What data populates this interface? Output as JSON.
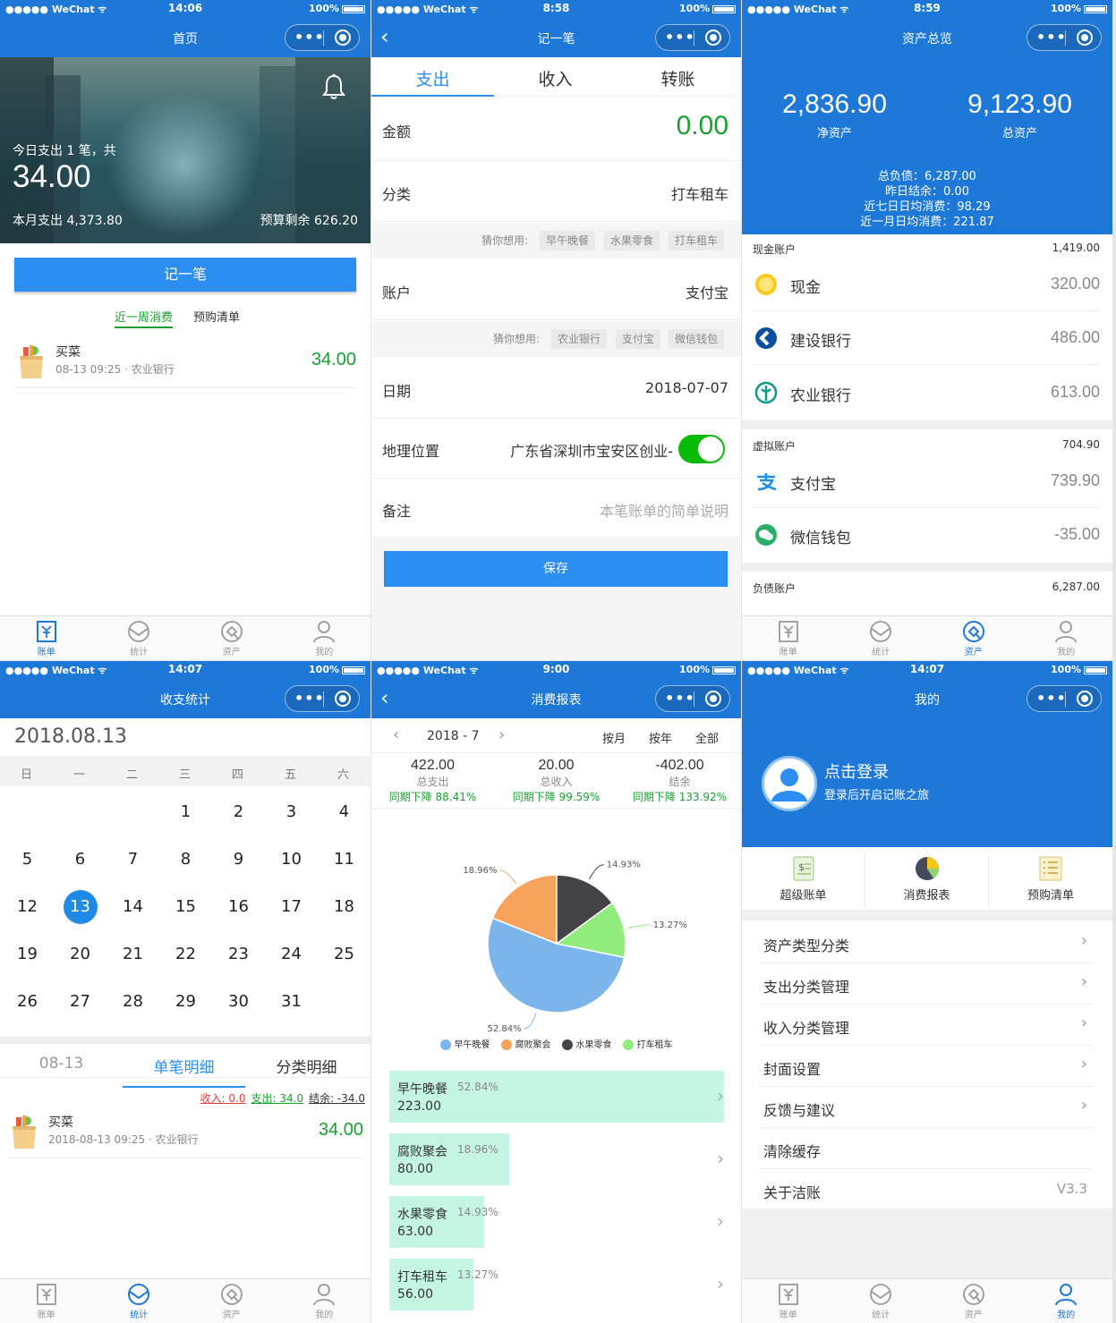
{
  "status": {
    "carrier": "●●●●● WeChat ᯤ",
    "battery": "100%",
    "times": [
      "14:06",
      "8:58",
      "8:59",
      "14:07",
      "9:00",
      "14:07"
    ]
  },
  "tabbar": {
    "bill": "账单",
    "stats": "统计",
    "assets": "资产",
    "me": "我的"
  },
  "screen1": {
    "title": "首页",
    "today_line": "今日支出 1 笔，共",
    "today_amount": "34.00",
    "month_spend": "本月支出 4,373.80",
    "budget_left": "预算剩余 626.20",
    "record_btn": "记一笔",
    "tab_week": "近一周消费",
    "tab_shop": "预购清单",
    "entry": {
      "name": "买菜",
      "meta": "08-13 09:25 · 农业银行",
      "amount": "34.00"
    }
  },
  "screen2": {
    "title": "记一笔",
    "tabs": [
      "支出",
      "收入",
      "转账"
    ],
    "amount_label": "金额",
    "amount_value": "0.00",
    "category_label": "分类",
    "category_value": "打车租车",
    "guess_label": "猜你想用:",
    "category_guesses": [
      "早午晚餐",
      "水果零食",
      "打车租车"
    ],
    "account_label": "账户",
    "account_value": "支付宝",
    "account_guesses": [
      "农业银行",
      "支付宝",
      "微信钱包"
    ],
    "date_label": "日期",
    "date_value": "2018-07-07",
    "location_label": "地理位置",
    "location_value": "广东省深圳市宝安区创业-",
    "location_on": true,
    "note_label": "备注",
    "note_placeholder": "本笔账单的简单说明",
    "save_btn": "保存"
  },
  "screen3": {
    "title": "资产总览",
    "net_assets": "2,836.90",
    "net_label": "净资产",
    "total_assets": "9,123.90",
    "total_label": "总资产",
    "summary": [
      "总负债：6,287.00",
      "昨日结余：0.00",
      "近七日日均消费：98.29",
      "近一月日均消费：221.87"
    ],
    "groups": [
      {
        "name": "现金账户",
        "total": "1,419.00",
        "items": [
          {
            "name": "现金",
            "value": "320.00",
            "icon": "coin-icon"
          },
          {
            "name": "建设银行",
            "value": "486.00",
            "icon": "ccb-icon"
          },
          {
            "name": "农业银行",
            "value": "613.00",
            "icon": "abc-icon"
          }
        ]
      },
      {
        "name": "虚拟账户",
        "total": "704.90",
        "items": [
          {
            "name": "支付宝",
            "value": "739.90",
            "icon": "alipay-icon"
          },
          {
            "name": "微信钱包",
            "value": "-35.00",
            "icon": "wechat-pay-icon"
          }
        ]
      },
      {
        "name": "负债账户",
        "total": "6,287.00"
      }
    ]
  },
  "screen4": {
    "title": "收支统计",
    "date": "2018.08.13",
    "weekdays": [
      "日",
      "一",
      "二",
      "三",
      "四",
      "五",
      "六"
    ],
    "days": [
      "1",
      "2",
      "3",
      "4",
      "5",
      "6",
      "7",
      "8",
      "9",
      "10",
      "11",
      "12",
      "13",
      "14",
      "15",
      "16",
      "17",
      "18",
      "19",
      "20",
      "21",
      "22",
      "23",
      "24",
      "25",
      "26",
      "27",
      "28",
      "29",
      "30",
      "31"
    ],
    "selected_day": "13",
    "tabs": [
      "08-13",
      "单笔明细",
      "分类明细"
    ],
    "income": "收入: 0.0",
    "expense": "支出: 34.0",
    "balance": "结余: -34.0",
    "entry": {
      "name": "买菜",
      "meta": "2018-08-13 09:25 · 农业银行",
      "amount": "34.00"
    }
  },
  "screen5": {
    "title": "消费报表",
    "period": "2018 - 7",
    "modes": [
      "按月",
      "按年",
      "全部"
    ],
    "stats": [
      {
        "value": "422.00",
        "label": "总支出",
        "change": "同期下降 88.41%"
      },
      {
        "value": "20.00",
        "label": "总收入",
        "change": "同期下降 99.59%"
      },
      {
        "value": "-402.00",
        "label": "结余",
        "change": "同期下降 133.92%"
      }
    ]
  },
  "chart_data": {
    "type": "pie",
    "categories": [
      "早午晚餐",
      "腐败聚会",
      "水果零食",
      "打车租车"
    ],
    "values": [
      52.84,
      18.96,
      14.93,
      13.27
    ],
    "value_labels": [
      "52.84%",
      "18.96%",
      "14.93%",
      "13.27%"
    ],
    "amounts": [
      "223.00",
      "80.00",
      "63.00",
      "56.00"
    ],
    "colors": [
      "#7cb5ec",
      "#f7a35c",
      "#434348",
      "#90ed7d"
    ],
    "legend_placement": "bottom"
  },
  "screen6": {
    "title": "我的",
    "login": "点击登录",
    "login_sub": "登录后开启记账之旅",
    "shortcuts": [
      "超级账单",
      "消费报表",
      "预购清单"
    ],
    "menu": [
      "资产类型分类",
      "支出分类管理",
      "收入分类管理",
      "封面设置",
      "反馈与建议",
      "清除缓存",
      "关于洁账"
    ],
    "version": "V3.3"
  }
}
